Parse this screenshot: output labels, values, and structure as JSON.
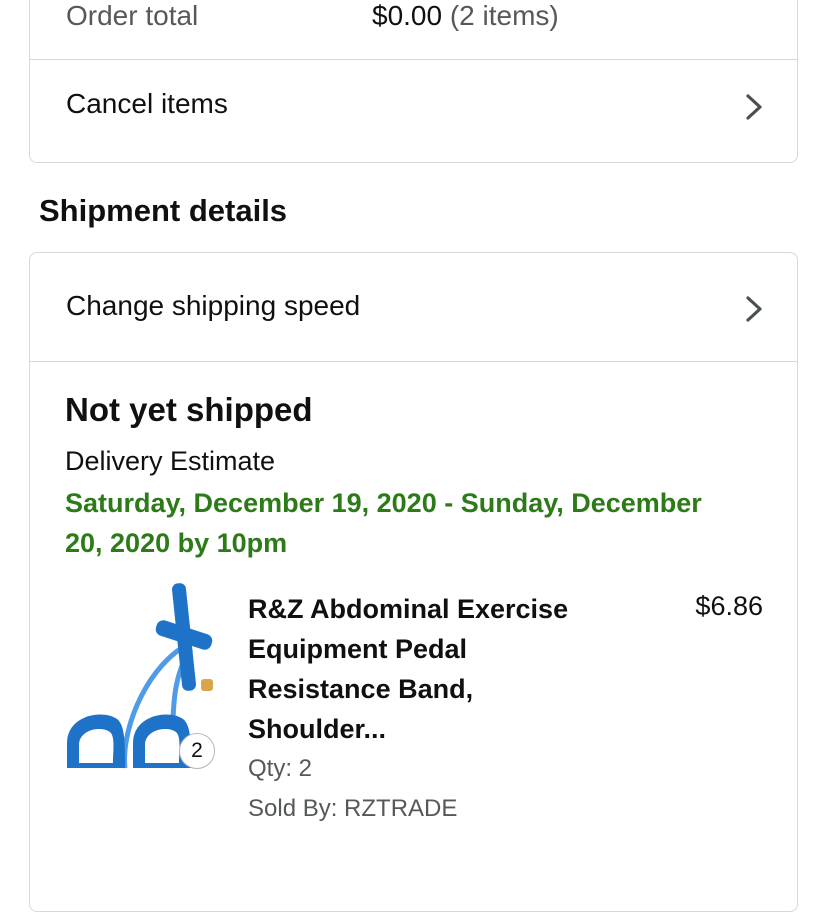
{
  "order_summary": {
    "total_label": "Order total",
    "total_value": "$0.00",
    "total_count": "(2 items)",
    "cancel_label": "Cancel items"
  },
  "shipment": {
    "section_title": "Shipment details",
    "change_speed_label": "Change shipping speed",
    "status": "Not yet shipped",
    "delivery_label": "Delivery Estimate",
    "delivery_dates": "Saturday, December 19, 2020 - Sunday, December 20, 2020 by 10pm",
    "item": {
      "title": "R&Z Abdominal Exercise Equipment Pedal Resistance Band, Shoulder...",
      "price": "$6.86",
      "qty": "Qty: 2",
      "seller": "Sold By: RZTRADE",
      "badge": "2"
    }
  },
  "icons": {
    "chevron": "chevron-right-icon"
  },
  "colors": {
    "delivery_green": "#2d7b18",
    "secondary_text": "#565959",
    "border": "#d5d9d9",
    "product_blue": "#1e73c8"
  }
}
